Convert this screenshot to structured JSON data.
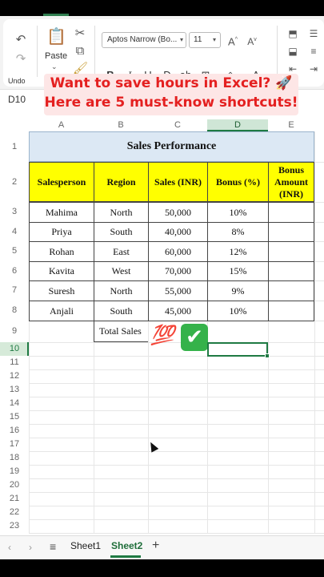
{
  "ribbon": {
    "undo_label": "Undo",
    "paste_label": "Paste",
    "font_name": "Aptos Narrow (Bo...",
    "font_size": "11"
  },
  "banner": {
    "line1": "Want to save hours in Excel? 🚀",
    "line2": "Here are 5 must-know shortcuts!"
  },
  "name_box": "D10",
  "columns": [
    "A",
    "B",
    "C",
    "D",
    "E"
  ],
  "rows": [
    "1",
    "2",
    "3",
    "4",
    "5",
    "6",
    "7",
    "8",
    "9",
    "10",
    "11",
    "12",
    "13",
    "14",
    "15",
    "16",
    "17",
    "18",
    "19",
    "20",
    "21",
    "22",
    "23"
  ],
  "table": {
    "title": "Sales Performance",
    "headers": [
      "Salesperson",
      "Region",
      "Sales (INR)",
      "Bonus (%)",
      "Bonus Amount (INR)"
    ],
    "rows": [
      [
        "Mahima",
        "North",
        "50,000",
        "10%",
        ""
      ],
      [
        "Priya",
        "South",
        "40,000",
        "8%",
        ""
      ],
      [
        "Rohan",
        "East",
        "60,000",
        "12%",
        ""
      ],
      [
        "Kavita",
        "West",
        "70,000",
        "15%",
        ""
      ],
      [
        "Suresh",
        "North",
        "55,000",
        "9%",
        ""
      ],
      [
        "Anjali",
        "South",
        "45,000",
        "10%",
        ""
      ]
    ],
    "total_label": "Total Sales"
  },
  "emoji": {
    "hundred": "💯",
    "check": "✔"
  },
  "sheets": {
    "tabs": [
      "Sheet1",
      "Sheet2"
    ],
    "active": "Sheet2",
    "add": "+"
  },
  "colors": {
    "accent": "#1f7a43",
    "title_fill": "#dce8f4",
    "header_fill": "#ffff00",
    "banner_text": "#e42020"
  }
}
